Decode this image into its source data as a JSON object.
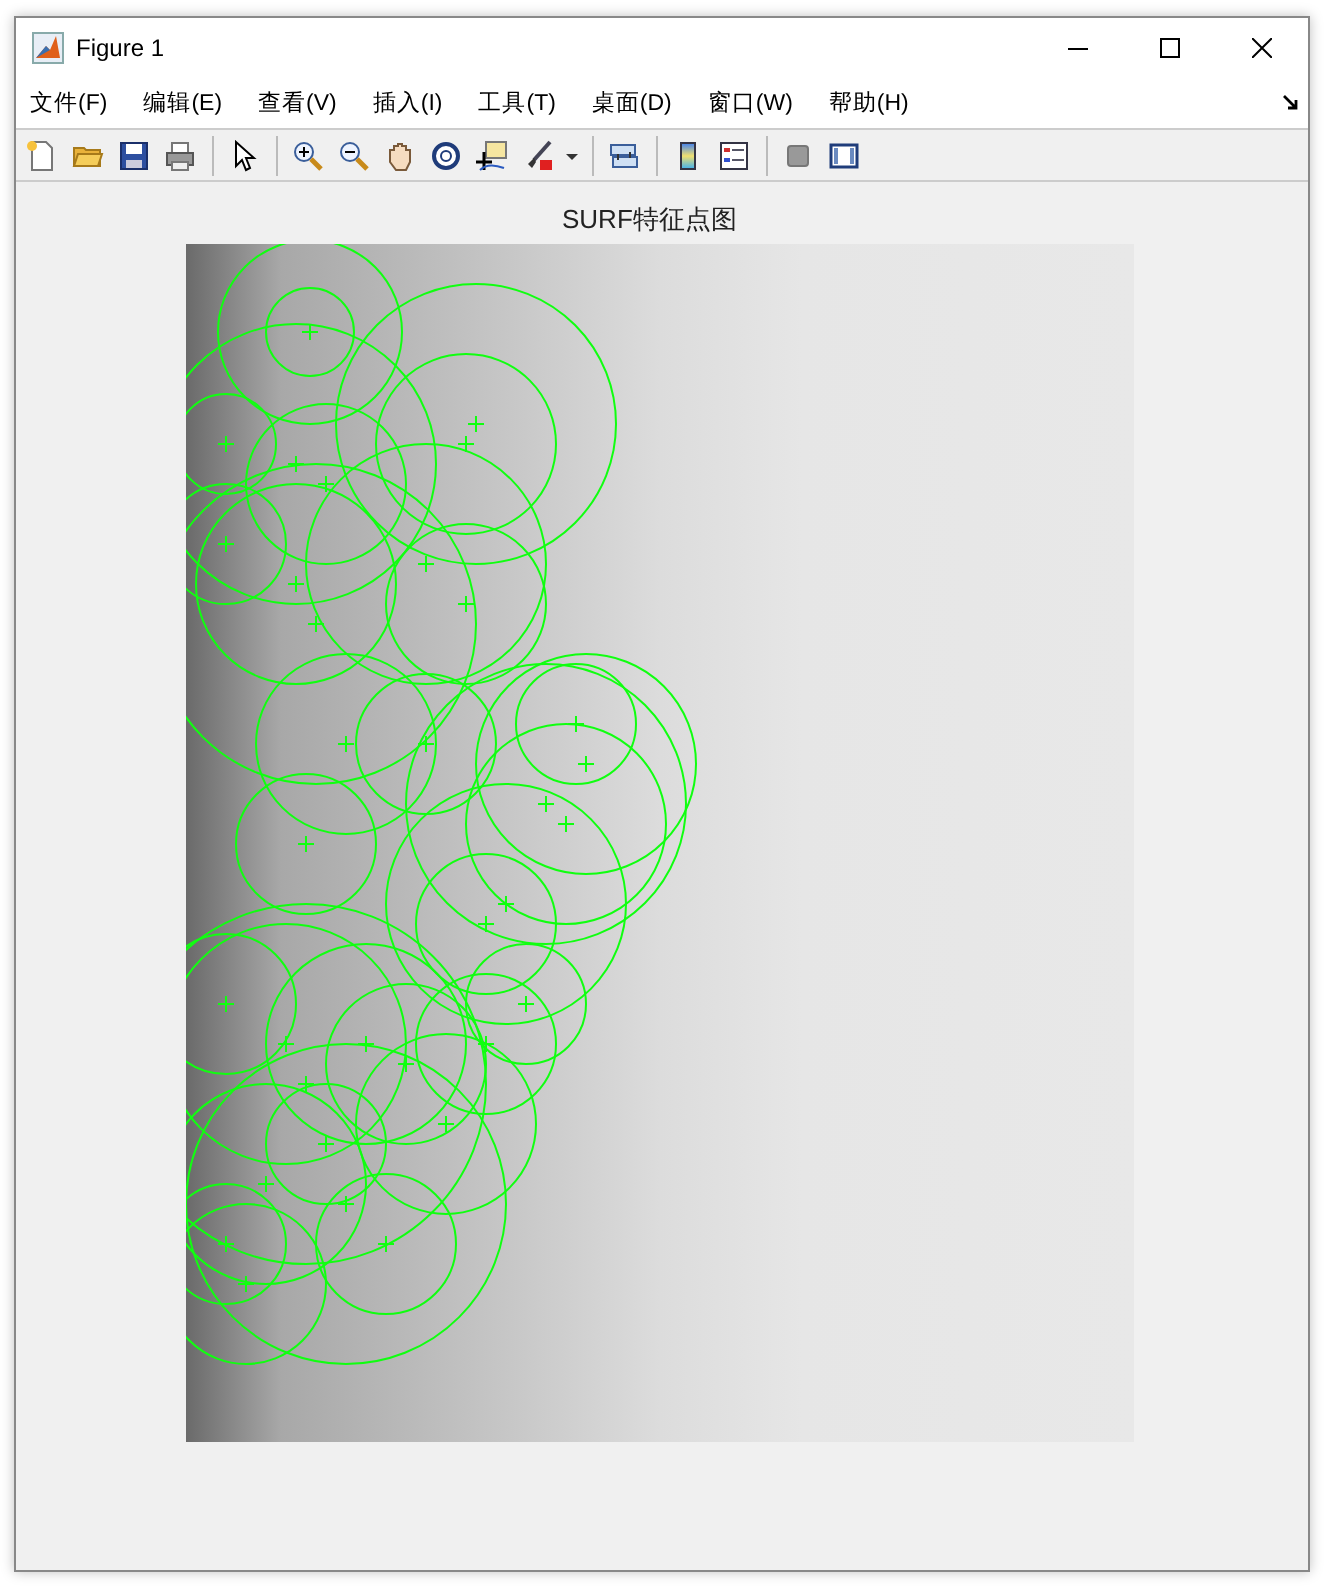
{
  "window": {
    "title": "Figure 1"
  },
  "menu": [
    "文件(F)",
    "编辑(E)",
    "查看(V)",
    "插入(I)",
    "工具(T)",
    "桌面(D)",
    "窗口(W)",
    "帮助(H)"
  ],
  "axes": {
    "title": "SURF特征点图"
  }
}
